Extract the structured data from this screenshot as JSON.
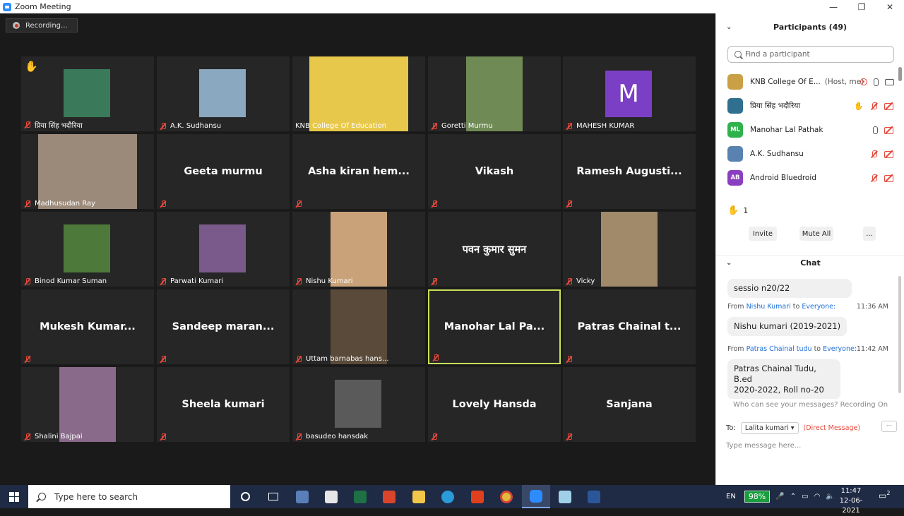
{
  "window": {
    "title": "Zoom Meeting",
    "min": "—",
    "max": "❐",
    "close": "✕"
  },
  "recording": {
    "label": "Recording..."
  },
  "tiles": [
    {
      "name": "प्रिया सिंह भदौरिया",
      "hand": "✋",
      "video": "#3a7a5a"
    },
    {
      "name": "A.K. Sudhansu",
      "video": "#8aa8c0"
    },
    {
      "name": "KNB College Of Education",
      "video": "#e8c84a",
      "noMic": true
    },
    {
      "name": "Goretti Murmu",
      "video": "#6f8a55"
    },
    {
      "name": "MAHESH KUMAR",
      "avatar": "M",
      "avatarColor": "#7b3fc6"
    },
    {
      "name": "Madhusudan Ray",
      "video": "#9b8a7a"
    },
    {
      "big": "Geeta murmu"
    },
    {
      "big": "Asha kiran hem..."
    },
    {
      "big": "Vikash"
    },
    {
      "big": "Ramesh Augusti..."
    },
    {
      "name": "Binod Kumar Suman",
      "video": "#4d7a3a"
    },
    {
      "name": "Parwati Kumari",
      "video": "#7a5a8a"
    },
    {
      "name": "Nishu Kumari",
      "video": "#c9a27a"
    },
    {
      "big": "पवन कुमार सुमन"
    },
    {
      "name": "Vicky",
      "video": "#a08a6a"
    },
    {
      "big": "Mukesh Kumar..."
    },
    {
      "big": "Sandeep maran..."
    },
    {
      "name": "Uttam barnabas hans...",
      "video": "#5a4a3a"
    },
    {
      "big": "Manohar Lal Pa...",
      "active": true
    },
    {
      "big": "Patras Chainal t..."
    },
    {
      "name": "Shalini Bajpai",
      "video": "#8a6a8a"
    },
    {
      "big": "Sheela kumari"
    },
    {
      "name": "basudeo hansdak",
      "video": "#5a5a5a"
    },
    {
      "big": "Lovely Hansda"
    },
    {
      "big": "Sanjana"
    }
  ],
  "participants": {
    "title": "Participants (49)",
    "search_placeholder": "Find a participant",
    "list": [
      {
        "name": "KNB College Of E...",
        "host": "(Host, me)",
        "color": "#c9a046",
        "initials": ""
      },
      {
        "name": "प्रिया सिंह भदौरिया",
        "color": "#2f6f8f",
        "initials": "",
        "hand": "✋"
      },
      {
        "name": "Manohar Lal Pathak",
        "color": "#2fb24c",
        "initials": "ML"
      },
      {
        "name": "A.K. Sudhansu",
        "color": "#5a82b0",
        "initials": ""
      },
      {
        "name": "Android Bluedroid",
        "color": "#8a3fc0",
        "initials": "AB"
      }
    ],
    "hands_icon": "✋",
    "hands_count": "1",
    "invite": "Invite",
    "mute_all": "Mute All",
    "more": "..."
  },
  "chat": {
    "title": "Chat",
    "messages": [
      {
        "text": "sessio n20/22"
      },
      {
        "from_label": "From",
        "sender": "Nishu Kumari",
        "to_label": "to",
        "recipient": "Everyone:",
        "time": "11:36 AM",
        "text": "Nishu kumari (2019-2021)"
      },
      {
        "from_label": "From",
        "sender": "Patras Chainal tudu",
        "to_label": "to",
        "recipient": "Everyone:",
        "time": "11:42 AM",
        "text1": "Patras Chainal Tudu, B.ed",
        "text2": "2020-2022, Roll no-20"
      }
    ],
    "who_can_see": "Who can see your messages? Recording On",
    "to_label": "To:",
    "to_value": "Lalita kumari ▾",
    "direct": "(Direct Message)",
    "more": "···",
    "placeholder": "Type message here..."
  },
  "taskbar": {
    "search": "Type here to search",
    "lang": "EN",
    "battery": "98%",
    "time": "11:47",
    "date": "12-06-2021",
    "notif_count": "2"
  }
}
